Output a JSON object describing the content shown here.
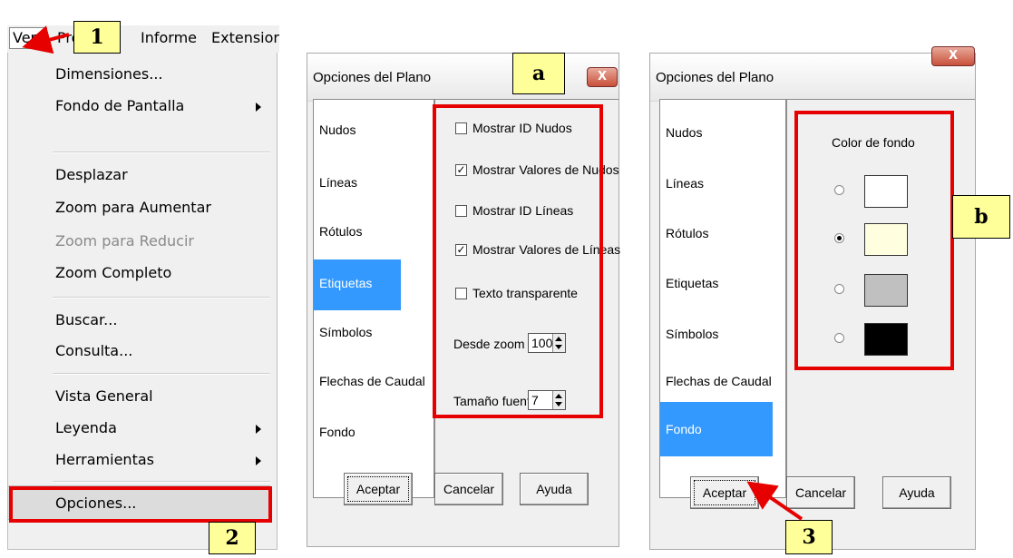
{
  "menubar": {
    "items": [
      "Ver",
      "Proyecto",
      "Informe",
      "Extensior"
    ]
  },
  "menu": {
    "items": [
      {
        "label": "Dimensiones...",
        "submenu": false,
        "disabled": false
      },
      {
        "label": "Fondo de Pantalla",
        "submenu": true,
        "disabled": false
      },
      {
        "label": "Desplazar",
        "submenu": false,
        "disabled": false
      },
      {
        "label": "Zoom para Aumentar",
        "submenu": false,
        "disabled": false
      },
      {
        "label": "Zoom para Reducir",
        "submenu": false,
        "disabled": true
      },
      {
        "label": "Zoom Completo",
        "submenu": false,
        "disabled": false
      },
      {
        "label": "Buscar...",
        "submenu": false,
        "disabled": false
      },
      {
        "label": "Consulta...",
        "submenu": false,
        "disabled": false
      },
      {
        "label": "Vista General",
        "submenu": false,
        "disabled": false
      },
      {
        "label": "Leyenda",
        "submenu": true,
        "disabled": false
      },
      {
        "label": "Herramientas",
        "submenu": true,
        "disabled": false
      },
      {
        "label": "Opciones...",
        "submenu": false,
        "disabled": false,
        "highlighted": true
      }
    ]
  },
  "callouts": {
    "c1": "1",
    "c2": "2",
    "c3": "3",
    "ca": "a",
    "cb": "b"
  },
  "dialog_a": {
    "title": "Opciones del Plano",
    "close": "X",
    "list": [
      "Nudos",
      "Líneas",
      "Rótulos",
      "Etiquetas",
      "Símbolos",
      "Flechas de Caudal",
      "Fondo"
    ],
    "selected": "Etiquetas",
    "options": [
      {
        "label": "Mostrar ID Nudos",
        "checked": false
      },
      {
        "label": "Mostrar Valores de Nudos",
        "checked": true
      },
      {
        "label": "Mostrar ID Líneas",
        "checked": false
      },
      {
        "label": "Mostrar Valores de Líneas",
        "checked": true
      },
      {
        "label": "Texto transparente",
        "checked": false
      }
    ],
    "desde_zoom_label": "Desde zoom",
    "desde_zoom_value": "100",
    "tamano_fuente_label": "Tamaño fuente",
    "tamano_fuente_value": "7",
    "buttons": {
      "aceptar": "Aceptar",
      "cancelar": "Cancelar",
      "ayuda": "Ayuda"
    }
  },
  "dialog_b": {
    "title": "Opciones del Plano",
    "close": "X",
    "list": [
      "Nudos",
      "Líneas",
      "Rótulos",
      "Etiquetas",
      "Símbolos",
      "Flechas de Caudal",
      "Fondo"
    ],
    "selected": "Fondo",
    "color_title": "Color de fondo",
    "colors": [
      {
        "color": "#ffffff",
        "selected": false
      },
      {
        "color": "#ffffe0",
        "selected": true
      },
      {
        "color": "#c0c0c0",
        "selected": false
      },
      {
        "color": "#000000",
        "selected": false
      }
    ],
    "buttons": {
      "aceptar": "Aceptar",
      "cancelar": "Cancelar",
      "ayuda": "Ayuda"
    }
  },
  "colors": {
    "highlight_red": "#e60000",
    "callout_yellow": "#ffff99",
    "selection_blue": "#3399ff"
  }
}
